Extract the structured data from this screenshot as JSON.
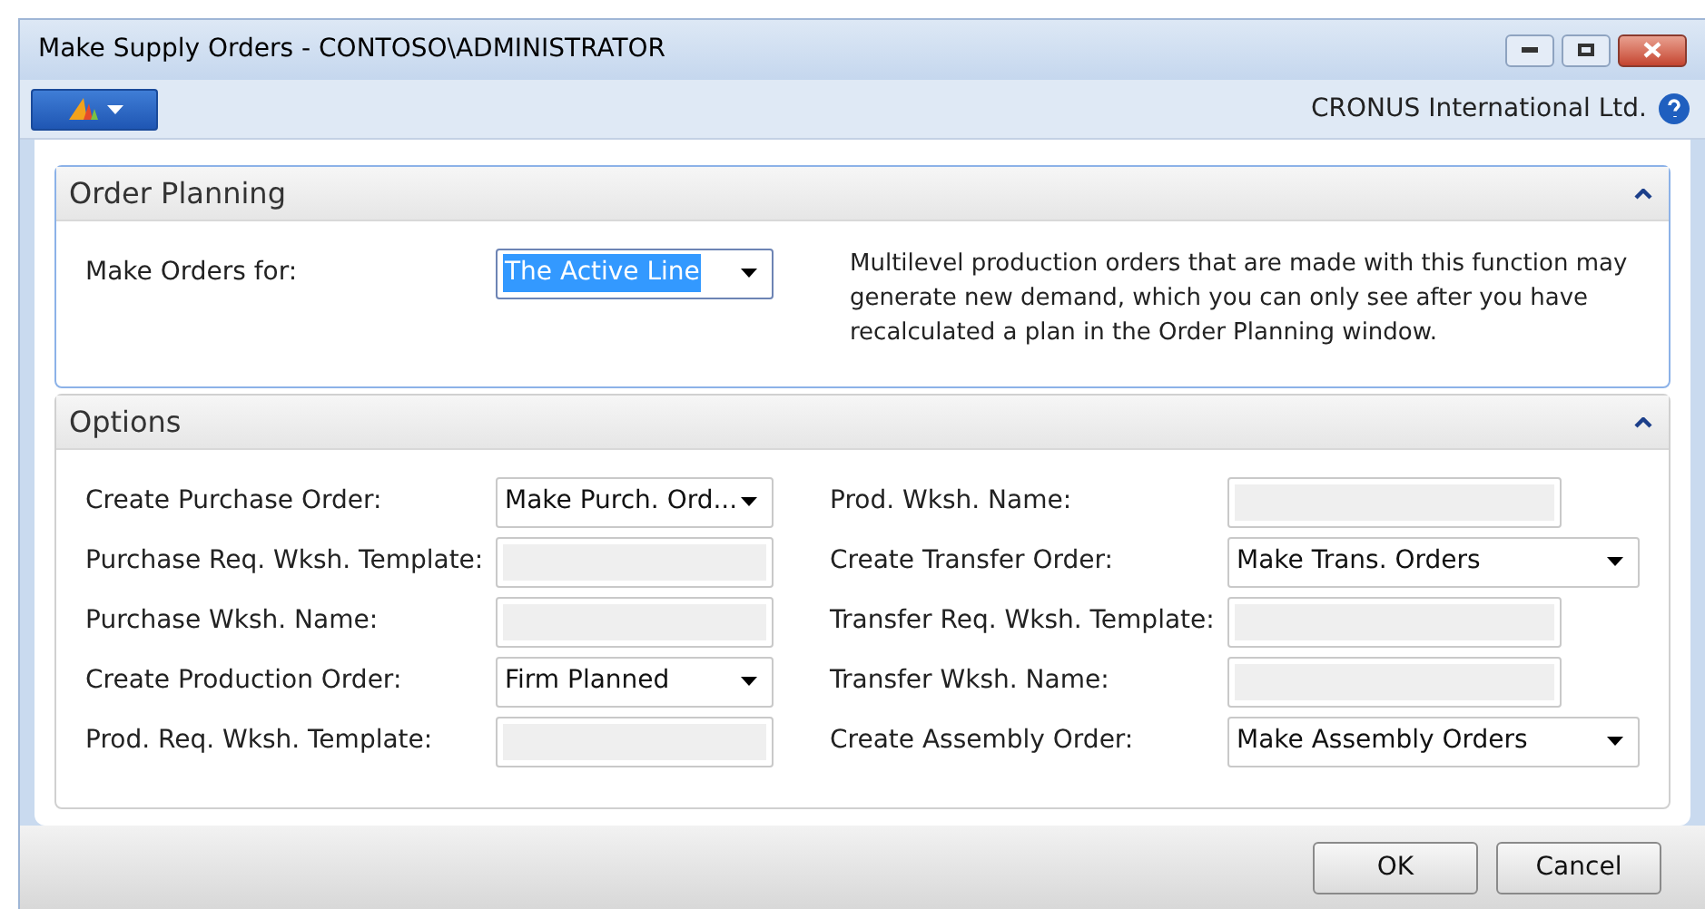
{
  "window": {
    "title": "Make Supply Orders - CONTOSO\\ADMINISTRATOR"
  },
  "company": "CRONUS International Ltd.",
  "sections": [
    {
      "title": "Order Planning",
      "expanded": true,
      "focused": true,
      "note": "Multilevel production orders that are made with this function may generate new demand, which you can only see after you have recalculated a plan in the Order Planning window.",
      "left": [
        {
          "label": "Make Orders for:",
          "kind": "dropdown",
          "value": "The Active Line",
          "focused": true
        }
      ]
    },
    {
      "title": "Options",
      "expanded": true,
      "focused": false,
      "left": [
        {
          "label": "Create Purchase Order:",
          "kind": "dropdown",
          "value": "Make Purch. Ord...",
          "focused": false
        },
        {
          "label": "Purchase Req. Wksh. Template:",
          "kind": "text",
          "focused": false
        },
        {
          "label": "Purchase Wksh. Name:",
          "kind": "text",
          "focused": false
        },
        {
          "label": "Create Production Order:",
          "kind": "dropdown",
          "value": "Firm Planned",
          "focused": false
        },
        {
          "label": "Prod. Req. Wksh. Template:",
          "kind": "text",
          "focused": false
        }
      ],
      "right": [
        {
          "label": "Prod. Wksh. Name:",
          "kind": "text",
          "focused": false
        },
        {
          "label": "Create Transfer Order:",
          "kind": "dropdown",
          "value": "Make Trans. Orders",
          "focused": false
        },
        {
          "label": "Transfer Req. Wksh. Template:",
          "kind": "text",
          "focused": false
        },
        {
          "label": "Transfer Wksh. Name:",
          "kind": "text",
          "focused": false
        },
        {
          "label": "Create Assembly Order:",
          "kind": "dropdown",
          "value": "Make Assembly Orders",
          "focused": false
        }
      ]
    }
  ],
  "buttons": [
    "OK",
    "Cancel"
  ]
}
